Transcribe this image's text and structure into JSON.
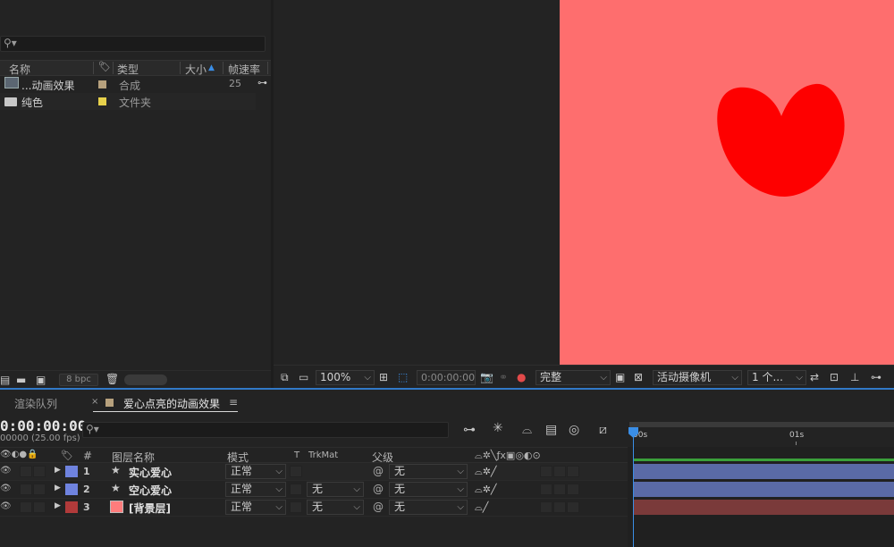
{
  "project": {
    "columns": {
      "name": "名称",
      "type": "类型",
      "size": "大小",
      "framerate": "帧速率"
    },
    "items": [
      {
        "name": "...动画效果",
        "type": "合成",
        "framerate": "25",
        "color": "#b7a17d"
      },
      {
        "name": "纯色",
        "type": "文件夹",
        "framerate": "",
        "color": "#e7d14b"
      }
    ],
    "bpc": "8 bpc"
  },
  "viewer": {
    "zoom": "100%",
    "timecode": "0:00:00:00",
    "resolution": "完整",
    "camera": "活动摄像机",
    "views": "1 个...",
    "background_color": "#fe6e6e",
    "heart_color": "#fe0000"
  },
  "timeline": {
    "tabs": {
      "render_queue": "渲染队列",
      "comp": "爱心点亮的动画效果"
    },
    "timecode": "0:00:00:00",
    "fps": "00000 (25.00 fps)",
    "columns": {
      "hash": "#",
      "layer_name": "图层名称",
      "mode": "模式",
      "t": "T",
      "trkmat": "TrkMat",
      "parent": "父级"
    },
    "ruler": {
      "start": "00s",
      "mark": "01s"
    },
    "layers": [
      {
        "num": "1",
        "name": "实心爱心",
        "mode": "正常",
        "trkmat": "",
        "parent": "无",
        "color": "#6f83df",
        "bar": "#5a6aa6"
      },
      {
        "num": "2",
        "name": "空心爱心",
        "mode": "正常",
        "trkmat": "无",
        "parent": "无",
        "color": "#6f83df",
        "bar": "#5a6aa6"
      },
      {
        "num": "3",
        "name": "[背景层]",
        "mode": "正常",
        "trkmat": "无",
        "parent": "无",
        "color": "#b13a3a",
        "bar": "#7a3a3a"
      }
    ]
  }
}
